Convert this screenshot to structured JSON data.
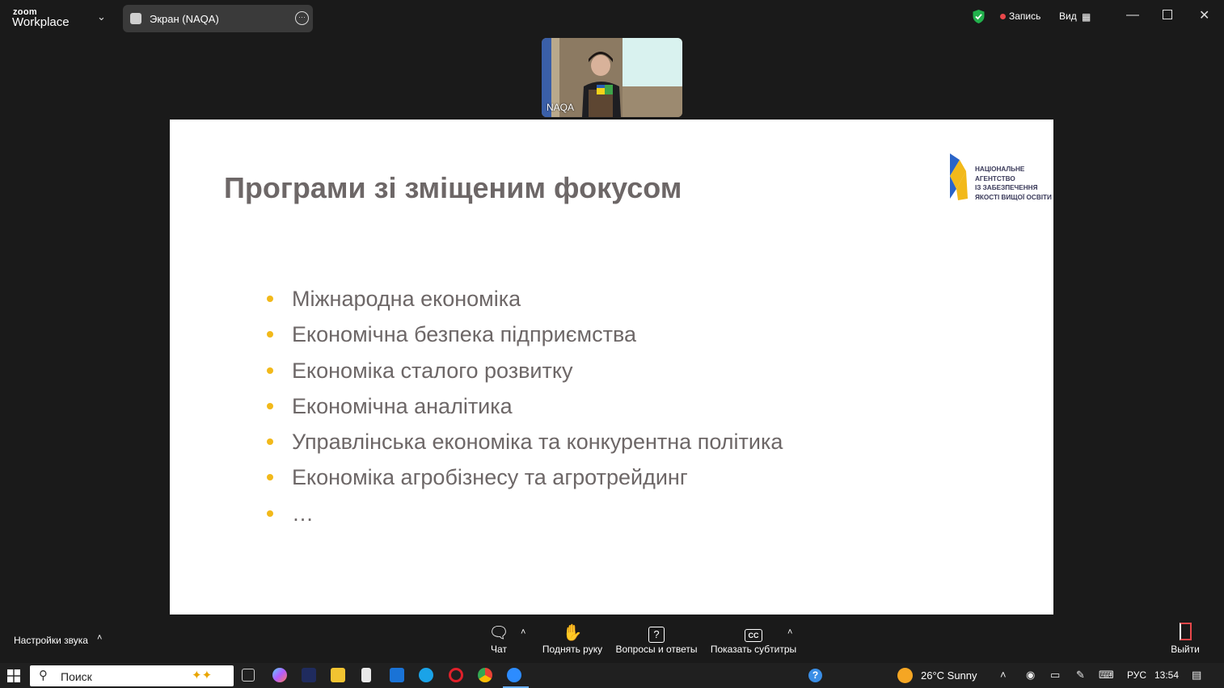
{
  "titlebar": {
    "app_brand_top": "zoom",
    "app_brand_bottom": "Workplace",
    "screen_tab_label": "Экран (NAQA)",
    "record_label": "Запись",
    "view_label": "Вид"
  },
  "video": {
    "participant_name": "NAQA"
  },
  "slide": {
    "title": "Програми зі зміщеним фокусом",
    "logo_lines": [
      "НАЦІОНАЛЬНЕ",
      "АГЕНТСТВО",
      "ІЗ ЗАБЕЗПЕЧЕННЯ",
      "ЯКОСТІ ВИЩОЇ ОСВІТИ"
    ],
    "bullets": [
      "Міжнародна економіка",
      "Економічна безпека підприємства",
      "Економіка сталого розвитку",
      "Економічна аналітика",
      "Управлінська економіка та конкурентна політика",
      "Економіка агробізнесу та агротрейдинг",
      "…"
    ],
    "bullet_color": "#f2b91a"
  },
  "toolbar": {
    "audio_settings": "Настройки звука",
    "chat": "Чат",
    "raise_hand": "Поднять руку",
    "qa": "Вопросы и ответы",
    "captions": "Показать субтитры",
    "leave": "Выйти"
  },
  "taskbar": {
    "search_label": "Поиск",
    "weather": "26°C  Sunny",
    "language": "РУС",
    "time": "13:54"
  }
}
